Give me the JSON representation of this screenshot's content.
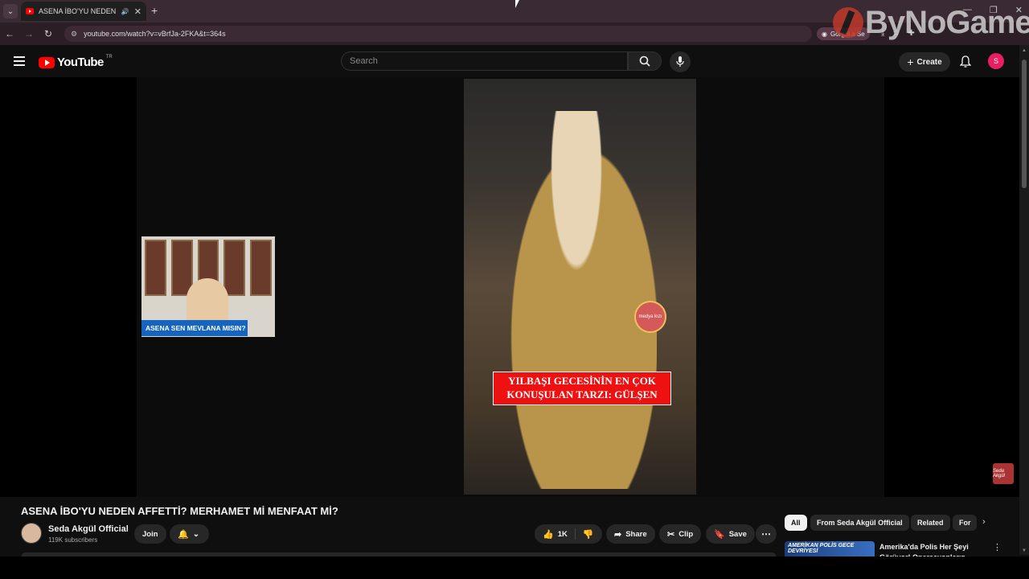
{
  "browser": {
    "tab_title": "ASENA İBO'YU NEDEN AFFETTİ",
    "tab_menu_icon": "chevron-down-icon",
    "url": "youtube.com/watch?v=vBrfJa-2FKA&t=364s",
    "gorgel_label": "Görgel a Se"
  },
  "watermark": {
    "text": "ByNoGame"
  },
  "youtube": {
    "logo_text": "YouTube",
    "region": "TR",
    "search_placeholder": "Search",
    "create_label": "Create",
    "avatar_letter": "S"
  },
  "video": {
    "clip_caption_line1": "YILBAŞI GECESİNİN EN ÇOK",
    "clip_caption_line2": "KONUŞULAN TARZI: GÜLŞEN",
    "sticker_text": "medya kızı",
    "host_caption": "ASENA SEN MEVLANA MISIN?",
    "corner_logo": "Seda Akgül"
  },
  "info": {
    "title": "ASENA İBO'YU NEDEN AFFETTİ? MERHAMET Mİ MENFAAT Mİ?",
    "channel_name": "Seda Akgül Official",
    "subscribers": "119K subscribers",
    "join_label": "Join",
    "like_count": "1K",
    "share_label": "Share",
    "clip_label": "Clip",
    "save_label": "Save"
  },
  "sidebar": {
    "chips": [
      "All",
      "From Seda Akgül Official",
      "Related",
      "For"
    ],
    "rec_thumb_text": "AMERİKAN POLİS GECE DEVRİYESİ",
    "rec_title": "Amerika'da Polis Her Şeyi Görüyor! Operasyonların Perde"
  }
}
